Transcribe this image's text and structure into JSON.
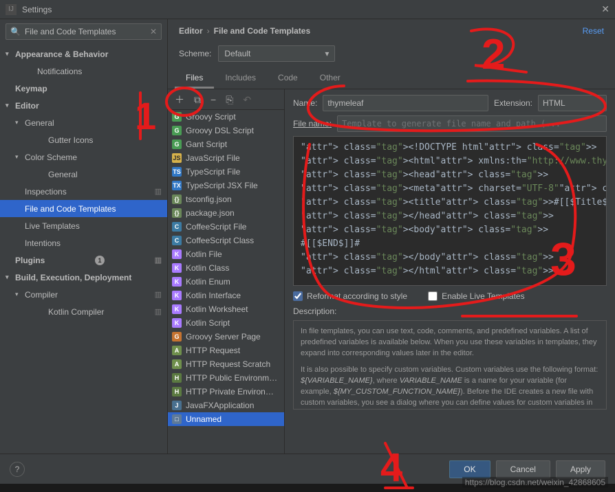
{
  "titlebar": {
    "title": "Settings"
  },
  "search": {
    "value": "File and Code Templates"
  },
  "sidebar": {
    "items": [
      {
        "label": "Appearance & Behavior",
        "bold": true,
        "chev": "v",
        "indent": 0
      },
      {
        "label": "Notifications",
        "indent": 2
      },
      {
        "label": "Keymap",
        "bold": true,
        "indent": 0
      },
      {
        "label": "Editor",
        "bold": true,
        "chev": "v",
        "indent": 0
      },
      {
        "label": "General",
        "chev": "v",
        "indent": 1
      },
      {
        "label": "Gutter Icons",
        "indent": 3
      },
      {
        "label": "Color Scheme",
        "chev": "v",
        "indent": 1
      },
      {
        "label": "General",
        "indent": 3
      },
      {
        "label": "Inspections",
        "indent": 1,
        "cfg": true
      },
      {
        "label": "File and Code Templates",
        "indent": 1,
        "selected": true
      },
      {
        "label": "Live Templates",
        "indent": 1
      },
      {
        "label": "Intentions",
        "indent": 1
      },
      {
        "label": "Plugins",
        "bold": true,
        "indent": 0,
        "badge": "1",
        "cfg": true
      },
      {
        "label": "Build, Execution, Deployment",
        "bold": true,
        "chev": "v",
        "indent": 0
      },
      {
        "label": "Compiler",
        "chev": "v",
        "indent": 1,
        "cfg": true
      },
      {
        "label": "Kotlin Compiler",
        "indent": 3,
        "cfg": true
      }
    ]
  },
  "breadcrumb": {
    "root": "Editor",
    "leaf": "File and Code Templates",
    "reset": "Reset"
  },
  "scheme": {
    "label": "Scheme:",
    "value": "Default"
  },
  "tabs": [
    {
      "label": "Files",
      "active": true
    },
    {
      "label": "Includes"
    },
    {
      "label": "Code"
    },
    {
      "label": "Other"
    }
  ],
  "file_list": [
    {
      "label": "Groovy Script",
      "ic": "ic-groovy",
      "g": "G"
    },
    {
      "label": "Groovy DSL Script",
      "ic": "ic-groovy",
      "g": "G"
    },
    {
      "label": "Gant Script",
      "ic": "ic-groovy",
      "g": "G"
    },
    {
      "label": "JavaScript File",
      "ic": "ic-js",
      "g": "JS"
    },
    {
      "label": "TypeScript File",
      "ic": "ic-ts",
      "g": "TS"
    },
    {
      "label": "TypeScript JSX File",
      "ic": "ic-ts",
      "g": "TX"
    },
    {
      "label": "tsconfig.json",
      "ic": "ic-json",
      "g": "{}"
    },
    {
      "label": "package.json",
      "ic": "ic-json",
      "g": "{}"
    },
    {
      "label": "CoffeeScript File",
      "ic": "ic-coffee",
      "g": "C"
    },
    {
      "label": "CoffeeScript Class",
      "ic": "ic-coffee",
      "g": "C"
    },
    {
      "label": "Kotlin File",
      "ic": "ic-kotlin",
      "g": "K"
    },
    {
      "label": "Kotlin Class",
      "ic": "ic-kotlin",
      "g": "K"
    },
    {
      "label": "Kotlin Enum",
      "ic": "ic-kotlin",
      "g": "K"
    },
    {
      "label": "Kotlin Interface",
      "ic": "ic-kotlin",
      "g": "K"
    },
    {
      "label": "Kotlin Worksheet",
      "ic": "ic-kotlin",
      "g": "K"
    },
    {
      "label": "Kotlin Script",
      "ic": "ic-kotlin",
      "g": "K"
    },
    {
      "label": "Groovy Server Page",
      "ic": "ic-jsp",
      "g": "G"
    },
    {
      "label": "HTTP Request",
      "ic": "ic-api",
      "g": "A"
    },
    {
      "label": "HTTP Request Scratch",
      "ic": "ic-api",
      "g": "A"
    },
    {
      "label": "HTTP Public Environment File",
      "ic": "ic-http",
      "g": "H"
    },
    {
      "label": "HTTP Private Environment File",
      "ic": "ic-http",
      "g": "H"
    },
    {
      "label": "JavaFXApplication",
      "ic": "ic-fx",
      "g": "J"
    },
    {
      "label": "Unnamed",
      "ic": "ic-new",
      "g": "□",
      "selected": true
    }
  ],
  "form": {
    "name_label": "Name:",
    "name_value": "thymeleaf",
    "ext_label": "Extension:",
    "ext_value": "HTML",
    "filename_label": "File name:",
    "filename_placeholder": "Template to generate file name and path (...",
    "code": "<!DOCTYPE html>\n<html xmlns:th=\"http://www.thymeleaf.org\">\n<head>\n<meta charset=\"UTF-8\">\n<title>#[[$Title$]]#</title>\n</head>\n<body>\n#[[$END$]]#\n</body>\n</html>",
    "reformat_label": "Reformat according to style",
    "enable_lt_label": "Enable Live Templates",
    "desc_label": "Description:",
    "desc_p1": "In file templates, you can use text, code, comments, and predefined variables. A list of predefined variables is available below. When you use these variables in templates, they expand into corresponding values later in the editor.",
    "desc_p2a": "It is also possible to specify custom variables. Custom variables use the following format: ",
    "desc_p2b": "${VARIABLE_NAME}",
    "desc_p2c": ", where ",
    "desc_p2d": "VARIABLE_NAME",
    "desc_p2e": " is a name for your variable (for example, ",
    "desc_p2f": "${MY_CUSTOM_FUNCTION_NAME}",
    "desc_p2g": "). Before the IDE creates a new file with custom variables, you see a dialog where you can define values for custom variables in the"
  },
  "footer": {
    "ok": "OK",
    "cancel": "Cancel",
    "apply": "Apply"
  },
  "watermark": "https://blog.csdn.net/weixin_42868605"
}
